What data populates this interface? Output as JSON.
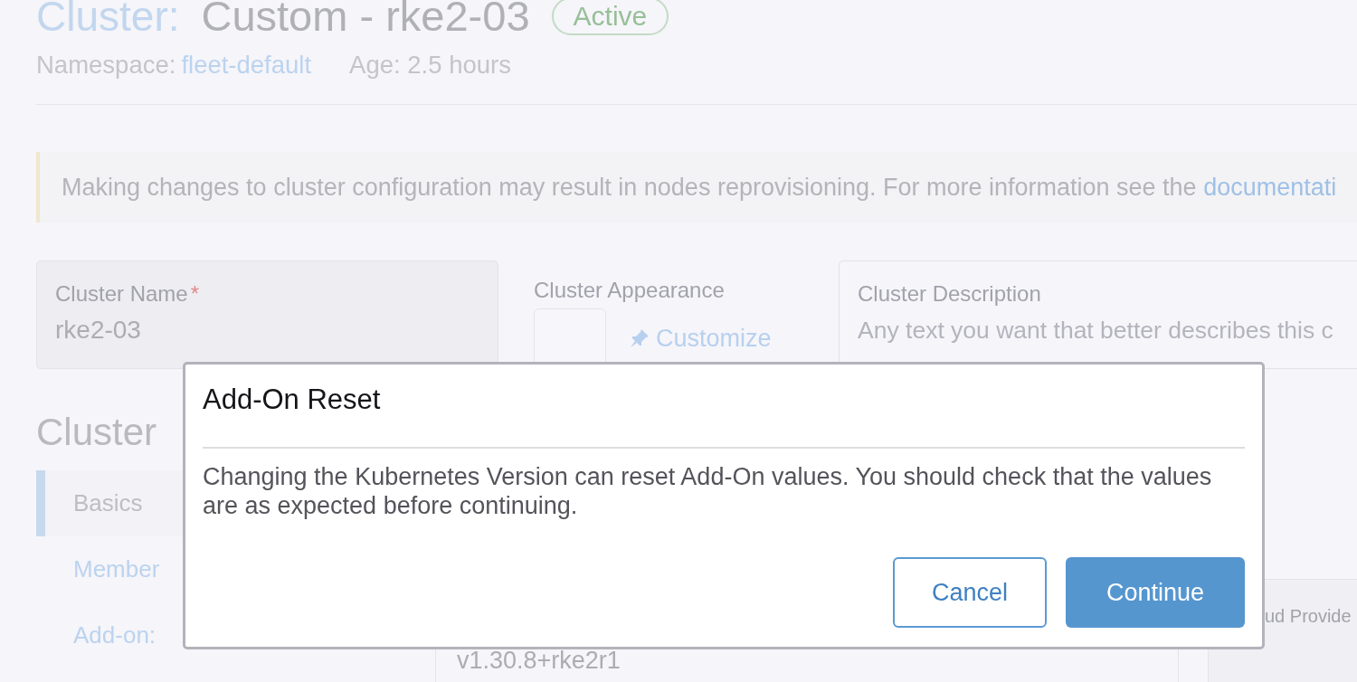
{
  "header": {
    "title_prefix": "Cluster:",
    "title": "Custom - rke2-03",
    "status": "Active",
    "namespace_label": "Namespace:",
    "namespace": "fleet-default",
    "age": "Age: 2.5 hours"
  },
  "banner": {
    "text": "Making changes to cluster configuration may result in nodes reprovisioning. For more information see the ",
    "link": "documentati"
  },
  "form": {
    "cluster_name": {
      "label": "Cluster Name",
      "required_mark": "*",
      "value": "rke2-03"
    },
    "appearance": {
      "label": "Cluster Appearance",
      "action": "Customize"
    },
    "description": {
      "label": "Cluster Description",
      "placeholder": "Any text you want that better describes this c"
    }
  },
  "section": {
    "heading": "Cluster"
  },
  "sidebar": {
    "items": [
      {
        "label": "Basics",
        "selected": true
      },
      {
        "label": "Member",
        "selected": false
      },
      {
        "label": "Add-on:",
        "selected": false
      }
    ]
  },
  "version_select": {
    "value": "v1.30.8+rke2r1"
  },
  "provider_select": {
    "label": "ud Provide"
  },
  "dialog": {
    "title": "Add-On Reset",
    "message": "Changing the Kubernetes Version can reset Add-On values. You should check that the values are as expected before continuing.",
    "buttons": [
      {
        "label": "Cancel",
        "kind": "secondary"
      },
      {
        "label": "Continue",
        "kind": "primary"
      }
    ]
  }
}
